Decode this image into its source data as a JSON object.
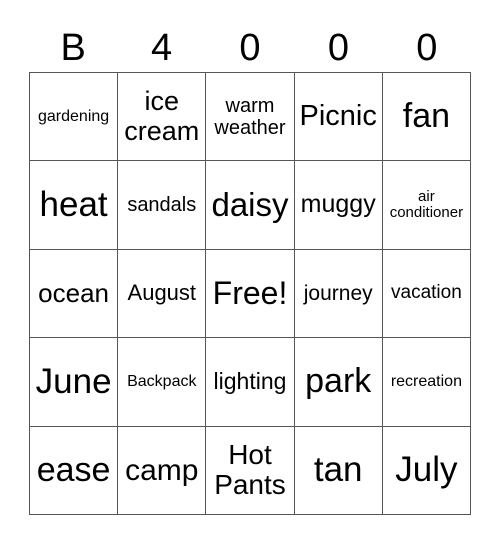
{
  "header": [
    "B",
    "4",
    "0",
    "0",
    "0"
  ],
  "cells": [
    "gardening",
    "ice cream",
    "warm weather",
    "Picnic",
    "fan",
    "heat",
    "sandals",
    "daisy",
    "muggy",
    "air conditioner",
    "ocean",
    "August",
    "Free!",
    "journey",
    "vacation",
    "June",
    "Backpack",
    "lighting",
    "park",
    "recreation",
    "ease",
    "camp",
    "Hot Pants",
    "tan",
    "July"
  ]
}
